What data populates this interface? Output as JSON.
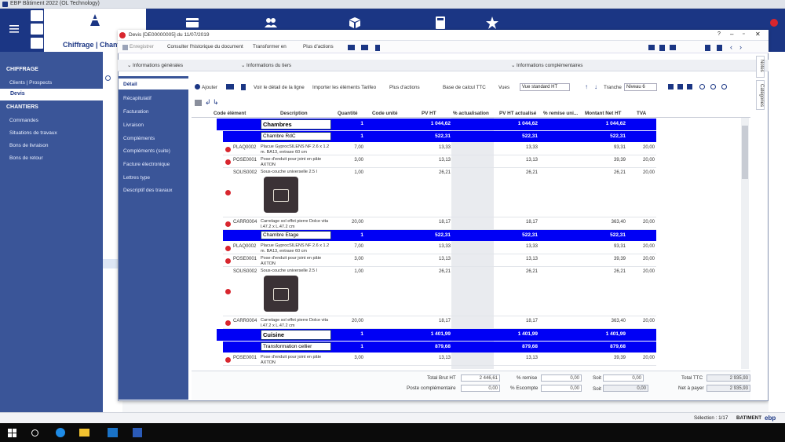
{
  "app": {
    "title": "EBP Bâtiment 2022 (OL Technology)",
    "section": "Chiffrage | Chantiers",
    "logo": "ebp-logo"
  },
  "sidebar": {
    "groups": [
      {
        "title": "CHIFFRAGE",
        "items": [
          "Clients | Prospects",
          "Devis"
        ]
      },
      {
        "title": "CHANTIERS",
        "items": [
          "Commandes",
          "Situations de travaux",
          "Bons de livraison",
          "Bons de retour"
        ]
      }
    ],
    "active": "Devis"
  },
  "window": {
    "title": "Devis [DE00000005] du 11/07/2019",
    "toolbar": [
      "Enregistrer",
      "Consulter l'historique du document",
      "Transformer en",
      "Plus d'actions"
    ],
    "sections": [
      "Informations générales",
      "Informations du tiers",
      "Informations complémentaires"
    ],
    "tabs": [
      "Détail",
      "Récapitulatif",
      "Facturation",
      "Livraison",
      "Compléments",
      "Compléments (suite)",
      "Facture électronique",
      "Lettres type",
      "Descriptif des travaux"
    ],
    "active_tab": "Détail",
    "right_tabs": [
      "Notes",
      "Catégories"
    ]
  },
  "grid_toolbar": {
    "add": "Ajouter",
    "detail": "Voir le détail de la ligne",
    "import": "Importer les éléments Tarifeo",
    "more": "Plus d'actions",
    "calc": "Base de calcul TTC",
    "views_label": "Vues",
    "view": "Vue standard HT",
    "tranche_label": "Tranche",
    "tranche": "Niveau 6"
  },
  "columns": [
    "Code élément",
    "Description",
    "Quantité",
    "Code unité",
    "PV HT",
    "% actualisation",
    "PV HT actualisé",
    "% remise uni...",
    "Montant Net HT",
    "TVA"
  ],
  "rows": [
    {
      "type": "level1",
      "desc": "Chambres",
      "qty": "1",
      "pv": "1 044,62",
      "pva": "1 044,62",
      "net": "1 044,62"
    },
    {
      "type": "level2",
      "desc": "Chambre RdC",
      "qty": "1",
      "pv": "522,31",
      "pva": "522,31",
      "net": "522,31"
    },
    {
      "type": "item",
      "code": "PLAQ0002",
      "desc": "Placue GyprocSILENS NF 2.6 x 1.2 m. BA13, entraxe 60 cm",
      "qty": "7,00",
      "pv": "13,33",
      "pva": "13,33",
      "net": "93,31",
      "tva": "20,00"
    },
    {
      "type": "item",
      "code": "POSE0001",
      "desc": "Pose d'enduit pour joint en pâte AXTON",
      "qty": "3,00",
      "pv": "13,13",
      "pva": "13,13",
      "net": "39,39",
      "tva": "20,00"
    },
    {
      "type": "image",
      "code": "SOUS0002",
      "desc": "Sous-couche universelle 2.5 l",
      "qty": "1,00",
      "pv": "26,21",
      "pva": "26,21",
      "net": "26,21",
      "tva": "20,00"
    },
    {
      "type": "item",
      "code": "CARR0004",
      "desc": "Carrelage sol effet pierre Dolce vita l.47.2 x L.47.2 cm",
      "qty": "20,00",
      "pv": "18,17",
      "pva": "18,17",
      "net": "363,40",
      "tva": "20,00"
    },
    {
      "type": "level2",
      "desc": "Chambre Etage",
      "qty": "1",
      "pv": "522,31",
      "pva": "522,31",
      "net": "522,31"
    },
    {
      "type": "item",
      "code": "PLAQ0002",
      "desc": "Placue GyprocSILENS NF 2.6 x 1.2 m. BA13, entraxe 60 cm",
      "qty": "7,00",
      "pv": "13,33",
      "pva": "13,33",
      "net": "93,31",
      "tva": "20,00"
    },
    {
      "type": "item",
      "code": "POSE0001",
      "desc": "Pose d'enduit pour joint en pâte AXTON",
      "qty": "3,00",
      "pv": "13,13",
      "pva": "13,13",
      "net": "39,39",
      "tva": "20,00"
    },
    {
      "type": "image",
      "code": "SOUS0002",
      "desc": "Sous-couche universelle 2.5 l",
      "qty": "1,00",
      "pv": "26,21",
      "pva": "26,21",
      "net": "26,21",
      "tva": "20,00"
    },
    {
      "type": "item",
      "code": "CARR0004",
      "desc": "Carrelage sol effet pierre Dolce vita l.47.2 x L.47.2 cm",
      "qty": "20,00",
      "pv": "18,17",
      "pva": "18,17",
      "net": "363,40",
      "tva": "20,00"
    },
    {
      "type": "level1",
      "desc": "Cuisine",
      "qty": "1",
      "pv": "1 401,99",
      "pva": "1 401,99",
      "net": "1 401,99"
    },
    {
      "type": "level2",
      "desc": "Transformation cellier",
      "qty": "1",
      "pv": "879,68",
      "pva": "879,68",
      "net": "879,68"
    },
    {
      "type": "item",
      "code": "POSE0001",
      "desc": "Pose d'enduit pour joint en pâte AXTON",
      "qty": "3,00",
      "pv": "13,13",
      "pva": "13,13",
      "net": "39,39",
      "tva": "20,00"
    }
  ],
  "totals": {
    "brut_label": "Total Brut HT",
    "brut": "2 446,61",
    "poste_label": "Poste complémentaire",
    "poste": "0,00",
    "remise_label": "% remise",
    "remise": "0,00",
    "escompte_label": "% Escompte",
    "escompte": "0,00",
    "soit_label": "Soit",
    "soit1": "0,00",
    "soit2": "0,00",
    "ttc_label": "Total TTC",
    "ttc": "2 935,93",
    "payer_label": "Net à payer",
    "payer": "2 935,93"
  },
  "status": {
    "selection": "Sélection : 1/17",
    "brand": "BATIMENT",
    "brand_logo": "ebp"
  },
  "colors": {
    "nav": "#1b3684",
    "sidebar": "#3a5598",
    "row_blue": "#0000f5"
  }
}
